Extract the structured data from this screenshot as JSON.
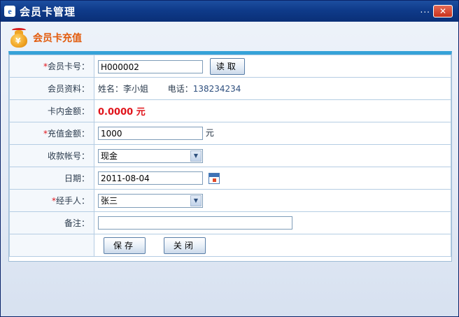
{
  "window": {
    "title": "会员卡管理",
    "dots": "...",
    "close": "✕"
  },
  "section": {
    "title": "会员卡充值"
  },
  "form": {
    "card_no": {
      "label": "会员卡号：",
      "value": "H000002",
      "button": "读取"
    },
    "member_info": {
      "label": "会员资料：",
      "name_label": "姓名：",
      "name_value": "李小姐",
      "phone_label": "电话：",
      "phone_value": "138234234"
    },
    "balance": {
      "label": "卡内金额：",
      "value": "0.0000 元"
    },
    "recharge": {
      "label": "充值金额：",
      "value": "1000",
      "unit": "元"
    },
    "account": {
      "label": "收款帐号：",
      "value": "现金"
    },
    "date": {
      "label": "日期：",
      "value": "2011-08-04"
    },
    "handler": {
      "label": "经手人：",
      "value": "张三"
    },
    "remark": {
      "label": "备注：",
      "value": ""
    },
    "save_label": "保存",
    "close_label": "关闭"
  }
}
